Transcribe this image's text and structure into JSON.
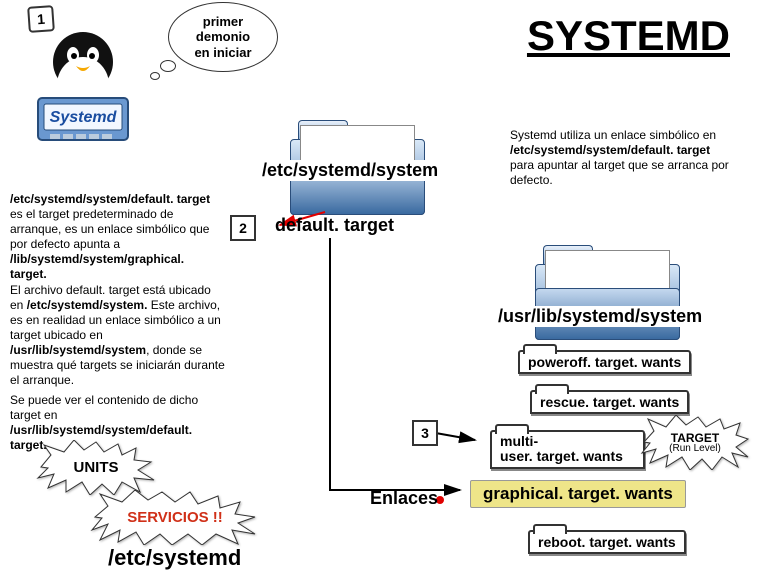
{
  "title": "SYSTEMD",
  "badges": {
    "one": "1",
    "two": "2",
    "three": "3"
  },
  "thought": "primer\ndemonio\nen iniciar",
  "folders": {
    "etc_system": "/etc/systemd/system",
    "default_target": "default. target",
    "usr_lib": "/usr/lib/systemd/system"
  },
  "notes": {
    "right_top": {
      "pre": "Systemd utiliza un enlace simbólico en",
      "bold": "/etc/systemd/system/default. target",
      "post": "para apuntar al target que se arranca por defecto."
    },
    "left1": {
      "bold_lead": "/etc/systemd/system/default. target",
      "t1": " es el target predeterminado de arranque, es un enlace simbólico que por defecto apunta a",
      "bold_tail": "/lib/systemd/system/graphical. target."
    },
    "left2": {
      "t1": "El archivo default. target está ubicado en ",
      "b1": "/etc/systemd/system.",
      "t2": " Este archivo, es en realidad un enlace simbólico a un target ubicado en ",
      "b2": "/usr/lib/systemd/system",
      "t3": ", donde se muestra qué targets se iniciarán durante el arranque."
    },
    "left3": {
      "t1": "Se puede ver el contenido de dicho target en ",
      "b1": "/usr/lib/systemd/system/default. target."
    }
  },
  "bursts": {
    "units": "UNITS",
    "servicios": "SERVICIOS !!",
    "target": {
      "line1": "TARGET",
      "line2": "(Run Level)"
    }
  },
  "files": {
    "poweroff": "poweroff. target. wants",
    "rescue": "rescue. target. wants",
    "multiuser_l1": "multi-",
    "multiuser_l2": "user. target. wants",
    "graphical": "graphical. target. wants",
    "reboot": "reboot. target. wants"
  },
  "labels": {
    "enlaces": "Enlaces",
    "etc_systemd": "/etc/systemd"
  }
}
